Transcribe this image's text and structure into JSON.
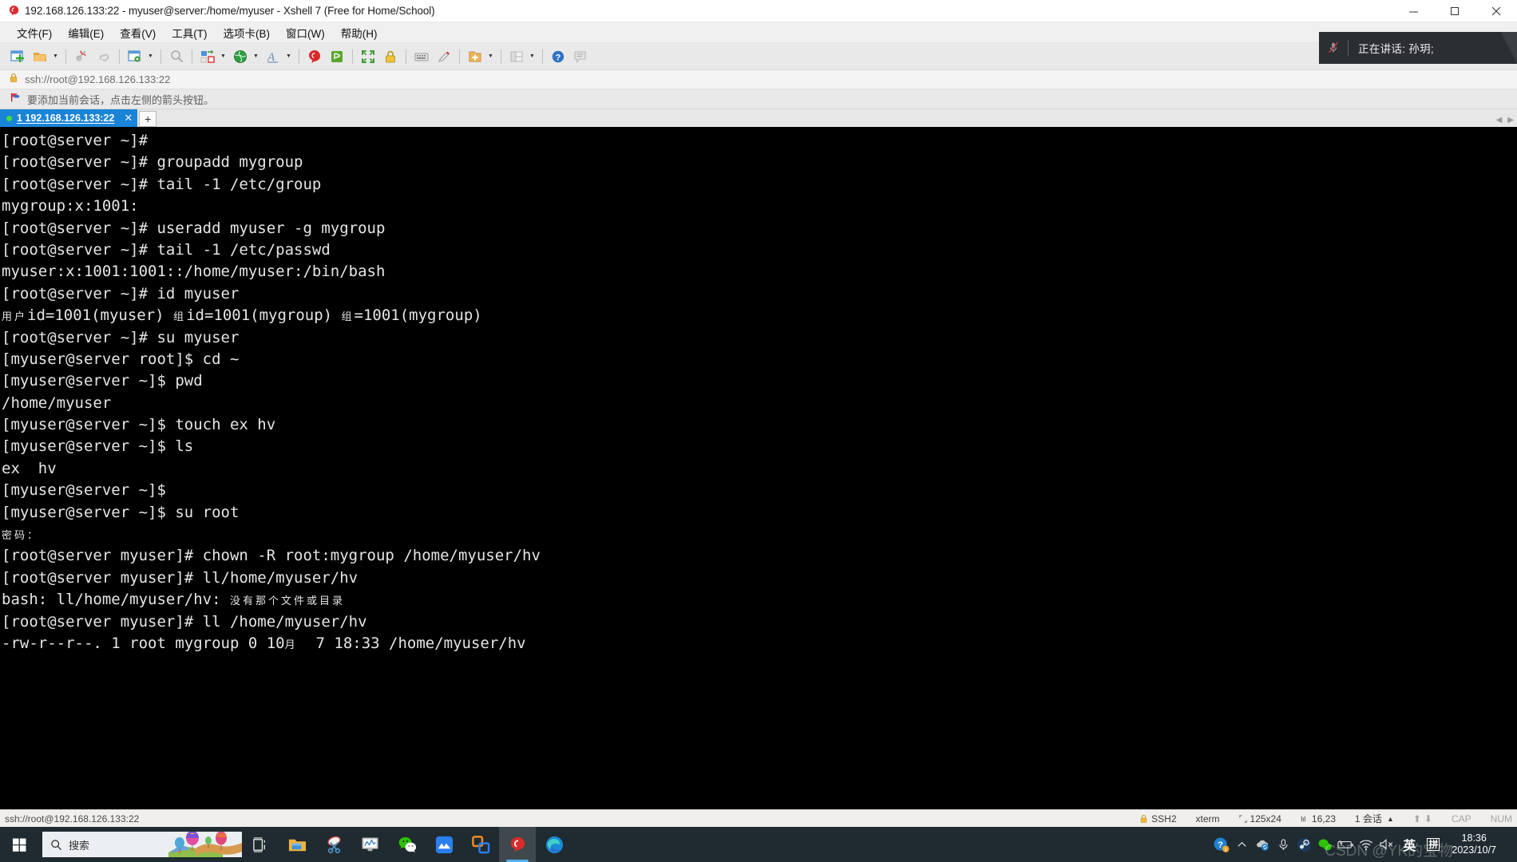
{
  "window": {
    "title": "192.168.126.133:22 - myuser@server:/home/myuser - Xshell 7 (Free for Home/School)",
    "app_icon": "xshell-logo-icon",
    "minimize": "–",
    "maximize": "☐",
    "close": "✕"
  },
  "menu": {
    "items": [
      {
        "label": "文件(F)",
        "name": "menu-file"
      },
      {
        "label": "编辑(E)",
        "name": "menu-edit"
      },
      {
        "label": "查看(V)",
        "name": "menu-view"
      },
      {
        "label": "工具(T)",
        "name": "menu-tools"
      },
      {
        "label": "选项卡(B)",
        "name": "menu-tabs"
      },
      {
        "label": "窗口(W)",
        "name": "menu-window"
      },
      {
        "label": "帮助(H)",
        "name": "menu-help"
      }
    ]
  },
  "toolbar": {
    "buttons": [
      "new-session-icon",
      "open-folder-icon",
      "disconnect-icon",
      "reconnect-icon",
      "session-properties-icon",
      "find-icon",
      "transfer-icon",
      "globe-icon",
      "font-icon",
      "xshell-icon",
      "xftp-icon",
      "fullscreen-icon",
      "lock-icon",
      "keyboard-icon",
      "highlight-icon",
      "compose-icon",
      "layout-icon",
      "help-icon",
      "comment-icon"
    ]
  },
  "speaking_banner": {
    "icon": "microphone-muted-icon",
    "text": "正在讲话: 孙玥;"
  },
  "address_bar": {
    "icon": "lock-icon",
    "value": "ssh://root@192.168.126.133:22"
  },
  "hint_bar": {
    "icon": "red-flag-icon",
    "text": "要添加当前会话，点击左侧的箭头按钮。"
  },
  "tabs": {
    "active": {
      "label": "1 192.168.126.133:22",
      "close": "✕",
      "status": "connected"
    },
    "new_tab": "+"
  },
  "terminal": {
    "lines": [
      {
        "text": "[root@server ~]# "
      },
      {
        "text": "[root@server ~]# groupadd mygroup"
      },
      {
        "text": "[root@server ~]# tail -1 /etc/group"
      },
      {
        "text": "mygroup:x:1001:"
      },
      {
        "text": "[root@server ~]# useradd myuser -g mygroup"
      },
      {
        "text": "[root@server ~]# tail -1 /etc/passwd"
      },
      {
        "text": "myuser:x:1001:1001::/home/myuser:/bin/bash"
      },
      {
        "text": "[root@server ~]# id myuser"
      },
      {
        "text": "用户id=1001(myuser) 组id=1001(mygroup) 组=1001(mygroup)",
        "cjk": true
      },
      {
        "text": "[root@server ~]# su myuser"
      },
      {
        "text": "[myuser@server root]$ cd ~"
      },
      {
        "text": "[myuser@server ~]$ pwd"
      },
      {
        "text": "/home/myuser"
      },
      {
        "text": "[myuser@server ~]$ touch ex hv"
      },
      {
        "text": "[myuser@server ~]$ ls"
      },
      {
        "text": "ex  hv"
      },
      {
        "text": "[myuser@server ~]$ "
      },
      {
        "text": "[myuser@server ~]$ su root"
      },
      {
        "text": "密码：",
        "cjk_small": true
      },
      {
        "text": "[root@server myuser]# chown -R root:mygroup /home/myuser/hv"
      },
      {
        "text": "[root@server myuser]# ll/home/myuser/hv"
      },
      {
        "text": "bash: ll/home/myuser/hv: 没有那个文件或目录",
        "cjk_small": true
      },
      {
        "text": "[root@server myuser]# ll /home/myuser/hv"
      },
      {
        "text": "-rw-r--r--. 1 root mygroup 0 10月  7 18:33 /home/myuser/hv"
      }
    ]
  },
  "status_bar": {
    "connection": "ssh://root@192.168.126.133:22",
    "protocol": "SSH2",
    "terminal_type": "xterm",
    "size": "125x24",
    "cursor": "16,23",
    "sessions": "1 会话",
    "cap": "CAP",
    "num": "NUM"
  },
  "taskbar": {
    "start": "windows-logo-icon",
    "search_placeholder": "搜索",
    "search_icon": "search-icon",
    "items": [
      {
        "name": "task-view-icon",
        "active": false
      },
      {
        "name": "file-explorer-icon",
        "active": false
      },
      {
        "name": "snipping-tool-icon",
        "active": false
      },
      {
        "name": "system-monitor-icon",
        "active": false
      },
      {
        "name": "wechat-icon",
        "active": false
      },
      {
        "name": "mountain-app-icon",
        "active": false
      },
      {
        "name": "vmware-workstation-icon",
        "active": false
      },
      {
        "name": "xshell-icon",
        "active": true
      },
      {
        "name": "microsoft-edge-icon",
        "active": false
      }
    ],
    "tray": [
      {
        "name": "help-question-icon"
      },
      {
        "name": "show-hidden-icons-chevron-icon"
      },
      {
        "name": "cloud-sync-icon"
      },
      {
        "name": "microphone-icon"
      },
      {
        "name": "steam-icon"
      },
      {
        "name": "wechat-tray-icon"
      },
      {
        "name": "battery-icon"
      },
      {
        "name": "wifi-icon"
      },
      {
        "name": "volume-muted-icon"
      }
    ],
    "ime_lang": "英",
    "ime_mode": "拼",
    "time": "18:36",
    "date": "2023/10/7"
  },
  "watermark": {
    "text": "CSDN @YK的宝物"
  },
  "colors": {
    "accent": "#1a84d6",
    "terminal_bg": "#000000",
    "terminal_fg": "#e6e6e6",
    "taskbar_bg": "#1f2b30",
    "banner_bg": "#2b2f33"
  }
}
